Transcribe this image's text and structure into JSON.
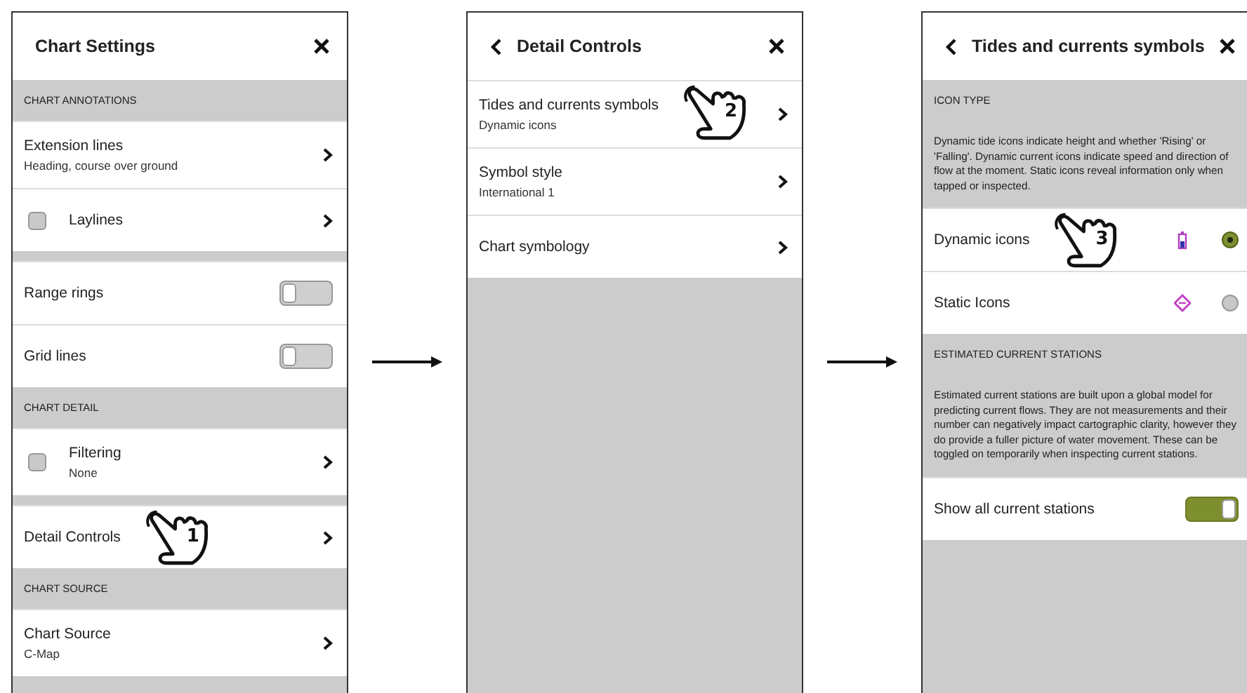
{
  "panels": [
    {
      "title": "Chart Settings",
      "back": false,
      "rows": [
        {
          "kind": "section",
          "label": "CHART ANNOTATIONS"
        },
        {
          "kind": "nav",
          "label": "Extension lines",
          "sub": "Heading, course over ground"
        },
        {
          "kind": "check",
          "label": "Laylines",
          "checked": false
        },
        {
          "kind": "spacer"
        },
        {
          "kind": "toggle",
          "label": "Range rings",
          "on": false
        },
        {
          "kind": "toggle",
          "label": "Grid lines",
          "on": false
        },
        {
          "kind": "section",
          "label": "CHART DETAIL"
        },
        {
          "kind": "check",
          "label": "Filtering",
          "sub": "None",
          "checked": false
        },
        {
          "kind": "spacer"
        },
        {
          "kind": "nav",
          "label": "Detail Controls",
          "tap": "1"
        },
        {
          "kind": "section",
          "label": "CHART SOURCE"
        },
        {
          "kind": "nav",
          "label": "Chart Source",
          "sub": "C-Map"
        }
      ]
    },
    {
      "title": "Detail Controls",
      "back": true,
      "rows": [
        {
          "kind": "nav",
          "label": "Tides and currents symbols",
          "sub": "Dynamic icons",
          "tap": "2"
        },
        {
          "kind": "nav",
          "label": "Symbol style",
          "sub": "International 1"
        },
        {
          "kind": "nav",
          "label": "Chart symbology"
        }
      ]
    },
    {
      "title": "Tides and currents symbols",
      "back": true,
      "rows": [
        {
          "kind": "section",
          "label": "ICON TYPE",
          "description": "Dynamic tide icons indicate height and whether 'Rising' or 'Falling'. Dynamic current icons indicate speed and direction of flow at the moment. Static icons reveal information only when tapped or inspected."
        },
        {
          "kind": "radio",
          "label": "Dynamic icons",
          "selected": true,
          "tap": "3"
        },
        {
          "kind": "radio",
          "label": "Static Icons",
          "selected": false
        },
        {
          "kind": "section",
          "label": "ESTIMATED CURRENT STATIONS",
          "description": "Estimated current stations are built upon a global model for predicting current flows. They are not measurements and their number can negatively impact cartographic clarity, however they do provide a fuller picture of water movement. These can be toggled on temporarily when inspecting current stations."
        },
        {
          "kind": "toggle",
          "label": "Show all current stations",
          "on": true
        }
      ]
    }
  ]
}
